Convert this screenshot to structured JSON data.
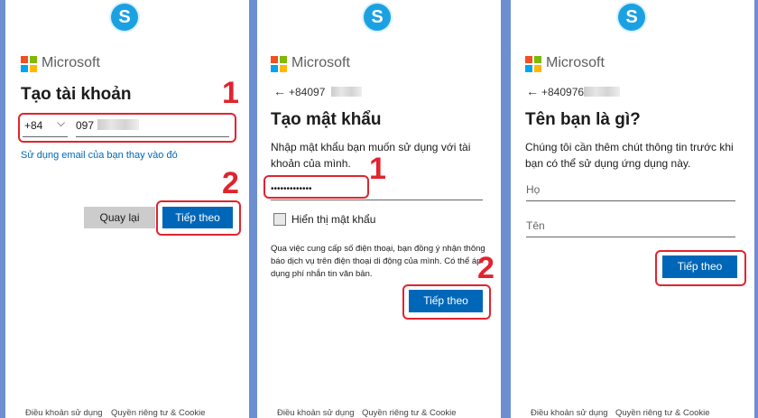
{
  "brand": {
    "skype_glyph": "S",
    "ms_name": "Microsoft"
  },
  "panel1": {
    "title": "Tạo tài khoản",
    "country_code": "+84",
    "phone_value": "097",
    "alt_link": "Sử dụng email của bạn thay vào đó",
    "back_button": "Quay lại",
    "next_button": "Tiếp theo",
    "marker1": "1",
    "marker2": "2",
    "footer_terms": "Điều khoản sử dụng",
    "footer_privacy": "Quyền riêng tư & Cookie"
  },
  "panel2": {
    "phone": "+84097",
    "title": "Tạo mật khẩu",
    "instruction": "Nhập mật khẩu bạn muốn sử dụng với tài khoản của mình.",
    "password_value": "•••••••••••••",
    "show_password": "Hiển thị mật khẩu",
    "disclaimer": "Qua việc cung cấp số điện thoại, bạn đồng ý nhận thông báo dịch vụ trên điện thoại di động của mình. Có thể áp dụng phí nhắn tin văn bản.",
    "next_button": "Tiếp theo",
    "marker1": "1",
    "marker2": "2",
    "footer_terms": "Điều khoản sử dụng",
    "footer_privacy": "Quyền riêng tư & Cookie"
  },
  "panel3": {
    "phone": "+840976",
    "title": "Tên bạn là gì?",
    "instruction": "Chúng tôi cần thêm chút thông tin trước khi bạn có thể sử dụng ứng dụng này.",
    "last_name_placeholder": "Họ",
    "first_name_placeholder": "Tên",
    "next_button": "Tiếp theo",
    "footer_terms": "Điều khoản sử dụng",
    "footer_privacy": "Quyền riêng tư & Cookie"
  },
  "colors": {
    "background": "#6d8fd1",
    "accent": "#0067b8",
    "annotation": "#e0242f",
    "skype": "#1ba1e2"
  },
  "icons": [
    "skype-icon",
    "microsoft-logo-icon",
    "chevron-down-icon",
    "back-arrow-icon",
    "checkbox-icon"
  ]
}
